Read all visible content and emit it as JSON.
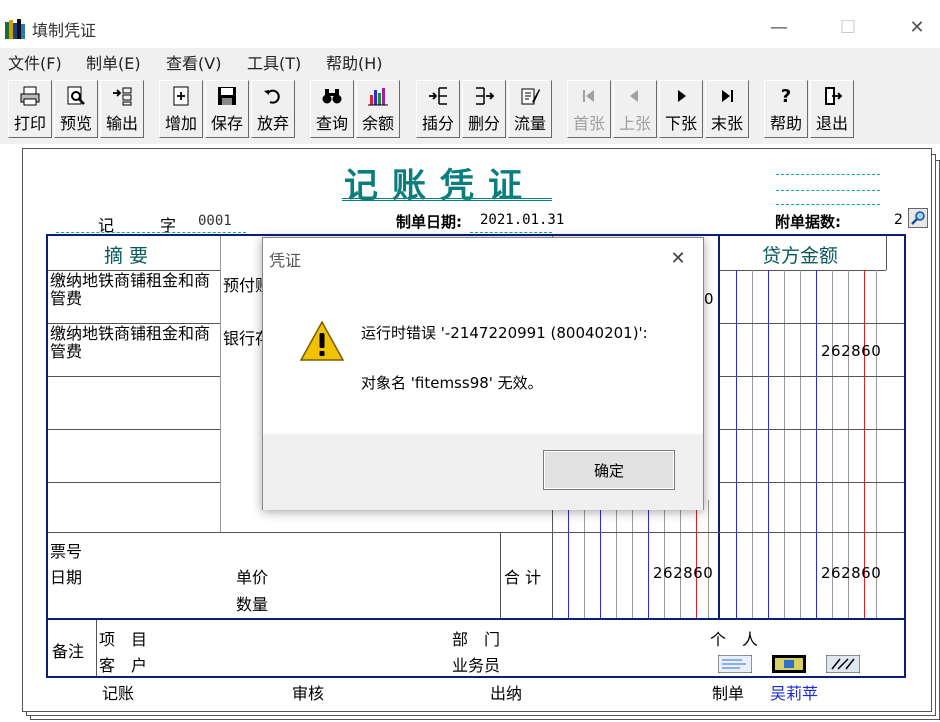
{
  "window": {
    "title": "填制凭证",
    "minimize": "—",
    "maximize": "☐",
    "close": "✕"
  },
  "menu": [
    "文件(F)",
    "制单(E)",
    "查看(V)",
    "工具(T)",
    "帮助(H)"
  ],
  "toolbar": [
    {
      "label": "打印",
      "icon": "printer-icon",
      "enabled": true
    },
    {
      "label": "预览",
      "icon": "preview-icon",
      "enabled": true
    },
    {
      "label": "输出",
      "icon": "export-icon",
      "enabled": true
    },
    {
      "label": "增加",
      "icon": "add-icon",
      "enabled": true
    },
    {
      "label": "保存",
      "icon": "save-icon",
      "enabled": true
    },
    {
      "label": "放弃",
      "icon": "undo-icon",
      "enabled": true
    },
    {
      "label": "查询",
      "icon": "binoculars-icon",
      "enabled": true
    },
    {
      "label": "余额",
      "icon": "bar-chart-icon",
      "enabled": true
    },
    {
      "label": "插分",
      "icon": "insert-row-icon",
      "enabled": true
    },
    {
      "label": "删分",
      "icon": "delete-row-icon",
      "enabled": true
    },
    {
      "label": "流量",
      "icon": "flow-icon",
      "enabled": true
    },
    {
      "label": "首张",
      "icon": "first-icon",
      "enabled": false
    },
    {
      "label": "上张",
      "icon": "prev-icon",
      "enabled": false
    },
    {
      "label": "下张",
      "icon": "next-icon",
      "enabled": true
    },
    {
      "label": "末张",
      "icon": "last-icon",
      "enabled": true
    },
    {
      "label": "帮助",
      "icon": "help-icon",
      "enabled": true
    },
    {
      "label": "退出",
      "icon": "exit-icon",
      "enabled": true
    }
  ],
  "voucher": {
    "title": "记账凭证",
    "type_label": "记",
    "type_suffix": "字",
    "number": "0001",
    "date_label": "制单日期:",
    "date": "2021.01.31",
    "attach_label": "附单据数:",
    "attach_count": "2",
    "col_summary": "摘 要",
    "col_credit": "贷方金额",
    "rows": [
      {
        "summary": "缴纳地铁商铺租金和商管费",
        "account": "预付账",
        "debit_tail": "0",
        "credit": ""
      },
      {
        "summary": "缴纳地铁商铺租金和商管费",
        "account": "银行存",
        "debit_tail": "",
        "credit": "262860"
      }
    ],
    "ticket_label": "票号",
    "date_row_label": "日期",
    "unit_price_label": "单价",
    "quantity_label": "数量",
    "total_label": "合 计",
    "total_debit": "262860",
    "total_credit": "262860",
    "remark_label": "备注",
    "project_label": "项　目",
    "customer_label": "客　户",
    "dept_label": "部　门",
    "person_label": "个　人",
    "salesman_label": "业务员",
    "bookkeep_label": "记账",
    "audit_label": "审核",
    "cashier_label": "出纳",
    "maker_label": "制单",
    "maker_name": "吴莉苹"
  },
  "dialog": {
    "title": "凭证",
    "message_line1": "运行时错误 '-2147220991 (80040201)':",
    "message_line2": "对象名 'fitemss98' 无效。",
    "ok_label": "确定"
  },
  "colors": {
    "title_teal": "#0a7d7d",
    "grid_blue": "#2a2ae0",
    "grid_red": "#e02020",
    "border_navy": "#0b1f7a",
    "maker_name_blue": "#1a2ad8"
  }
}
